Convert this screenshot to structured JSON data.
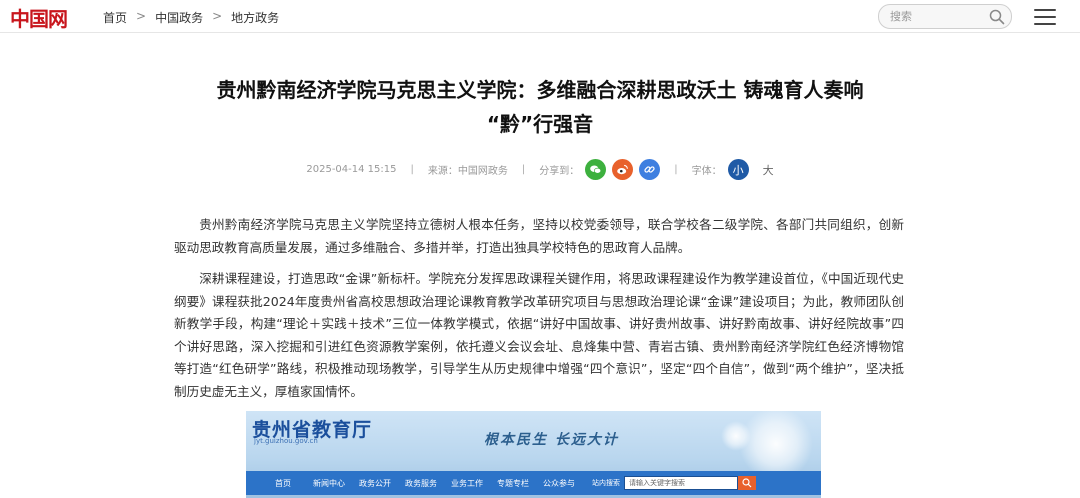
{
  "header": {
    "logo_text": "中国网",
    "breadcrumbs": [
      "首页",
      "中国政务",
      "地方政务"
    ],
    "breadcrumb_separator": ">",
    "search_placeholder": "搜索"
  },
  "article": {
    "title_line1": "贵州黔南经济学院马克思主义学院：多维融合深耕思政沃土 铸魂育人奏响",
    "title_line2": "“黔”行强音",
    "datetime": "2025-04-14 15:15",
    "source": "来源：中国网政务",
    "share_label": "分享到：",
    "font_label": "字体：",
    "font_small": "小",
    "font_large": "大",
    "paragraphs": [
      "贵州黔南经济学院马克思主义学院坚持立德树人根本任务，坚持以校党委领导，联合学校各二级学院、各部门共同组织，创新驱动思政教育高质量发展，通过多维融合、多措并举，打造出独具学校特色的思政育人品牌。",
      "深耕课程建设，打造思政“金课”新标杆。学院充分发挥思政课程关键作用，将思政课程建设作为教学建设首位，《中国近现代史纲要》课程获批2024年度贵州省高校思想政治理论课教育教学改革研究项目与思想政治理论课“金课”建设项目；为此，教师团队创新教学手段，构建“理论＋实践＋技术”三位一体教学模式，依据“讲好中国故事、讲好贵州故事、讲好黔南故事、讲好经院故事”四个讲好思路，深入挖掘和引进红色资源教学案例，依托遵义会议会址、息烽集中营、青岩古镇、贵州黔南经济学院红色经济博物馆等打造“红色研学”路线，积极推动现场教学，引导学生从历史规律中增强“四个意识”，坚定“四个自信”，做到“两个维护”，坚决抵制历史虚无主义，厚植家国情怀。"
    ]
  },
  "banner": {
    "title": "贵州省教育厅",
    "url": "jyt.guizhou.gov.cn",
    "slogan": "根本民生 长远大计",
    "nav_items": [
      "首页",
      "新闻中心",
      "政务公开",
      "政务服务",
      "业务工作",
      "专题专栏",
      "公众参与"
    ],
    "search_label": "站内搜索",
    "search_placeholder": "请输入关键字搜索"
  },
  "colors": {
    "brand_red": "#c8161d",
    "brand_blue": "#1a4fa3",
    "wechat_green": "#3db03e",
    "weibo_orange": "#e8612c",
    "link_blue": "#3e7fe0",
    "font_button_blue": "#1f5aa6"
  }
}
